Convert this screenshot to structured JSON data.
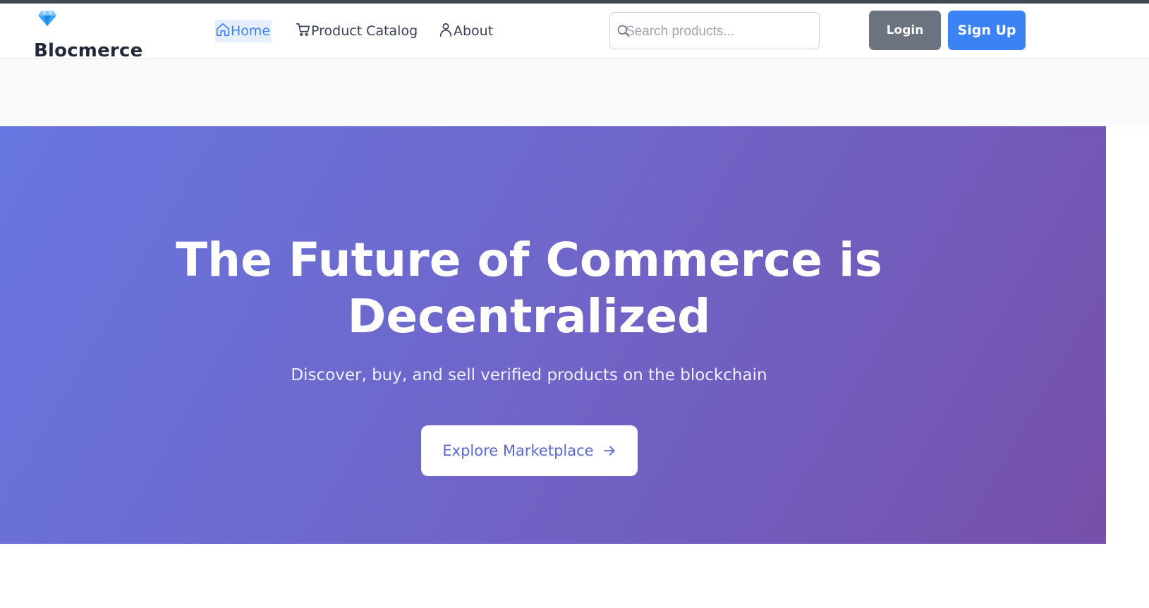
{
  "brand": {
    "name": "Blocmerce",
    "icon": "gem-icon"
  },
  "nav": {
    "items": [
      {
        "label": "Home",
        "icon": "home-icon",
        "active": true
      },
      {
        "label": "Product Catalog",
        "icon": "cart-icon",
        "active": false
      },
      {
        "label": "About",
        "icon": "user-icon",
        "active": false
      }
    ]
  },
  "search": {
    "placeholder": "Search products...",
    "value": "",
    "icon": "search-icon"
  },
  "auth": {
    "login_label": "Login",
    "signup_label": "Sign Up"
  },
  "hero": {
    "title_line1": "The Future of Commerce is",
    "title_line2": "Decentralized",
    "subtitle": "Discover, buy, and sell verified products on the blockchain",
    "cta_label": "Explore Marketplace",
    "cta_icon": "arrow-right-icon"
  },
  "colors": {
    "accent": "#3b82f6",
    "login_button": "#6b7280",
    "hero_gradient_start": "#6776e0",
    "hero_gradient_end": "#7650ab",
    "text_dark": "#1f2937"
  }
}
